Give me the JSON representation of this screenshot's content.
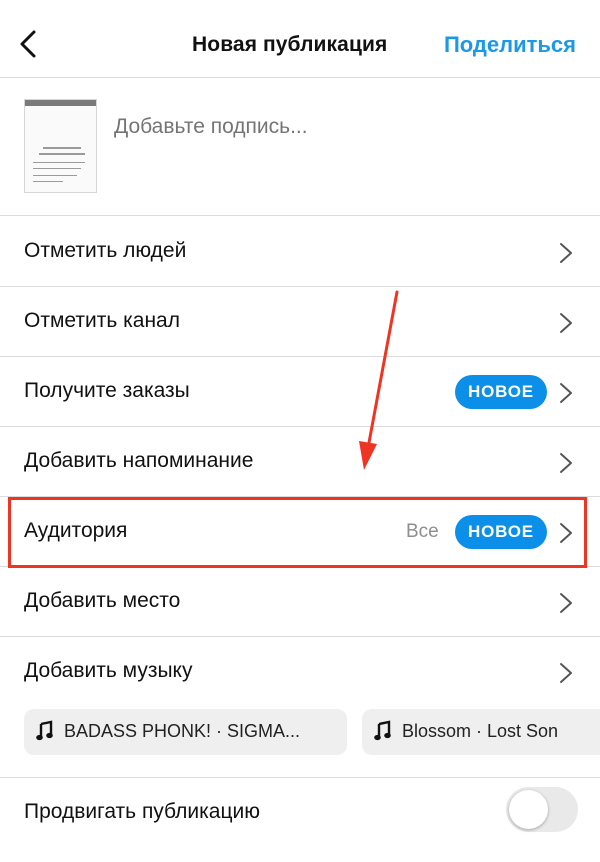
{
  "header": {
    "back_icon": "chevron-left-icon",
    "title": "Новая публикация",
    "share_label": "Поделиться"
  },
  "caption": {
    "placeholder": "Добавьте подпись..."
  },
  "menu": [
    {
      "label": "Отметить людей"
    },
    {
      "label": "Отметить канал"
    },
    {
      "label": "Получите заказы",
      "badge": "НОВОЕ"
    },
    {
      "label": "Добавить напоминание"
    },
    {
      "label": "Аудитория",
      "value": "Все",
      "badge": "НОВОЕ",
      "highlighted": true
    },
    {
      "label": "Добавить место"
    },
    {
      "label": "Добавить музыку"
    }
  ],
  "music_suggestions": [
    {
      "icon": "music-note-icon",
      "text": "BADASS PHONK! · SIGMA..."
    },
    {
      "icon": "music-note-icon",
      "text": "Blossom · Lost Son"
    }
  ],
  "promote": {
    "label": "Продвигать публикацию",
    "enabled": false
  },
  "colors": {
    "accent": "#1c98e8",
    "badge": "#0b8fe8",
    "highlight": "#ee3524",
    "divider": "#dbdbdb"
  }
}
